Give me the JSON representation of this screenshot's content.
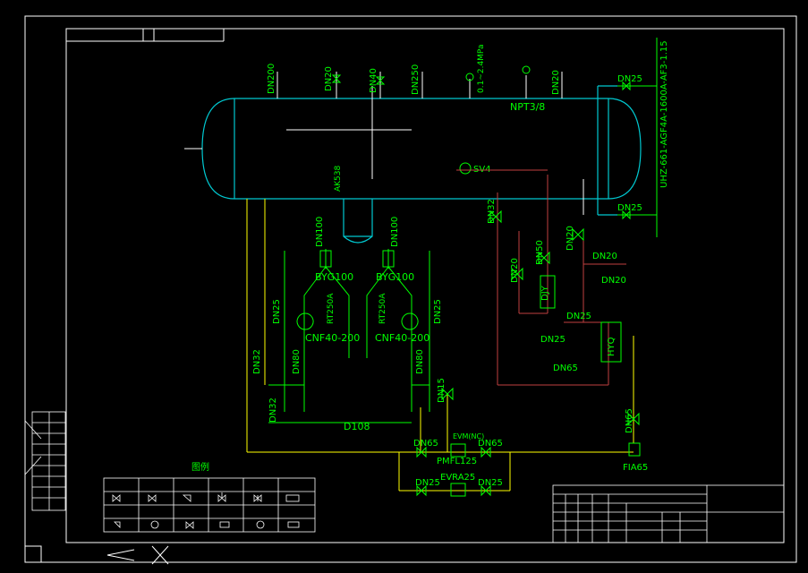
{
  "colors": {
    "background": "#000000",
    "frame": "#ffffff",
    "tank": "#00c8d0",
    "pipe_green": "#00ff00",
    "pipe_yellow": "#ffff00",
    "pipe_red": "#c04040",
    "magenta": "#ff00ff",
    "red_tag": "#ff2020"
  },
  "tank_labels": {
    "top_nozzles": [
      "DN200",
      "DN20",
      "DN40",
      "DN250",
      "DN20"
    ],
    "npt": "NPT3/8",
    "dn25_top": "DN25",
    "dn25_bottom": "DN25",
    "side_line": "UHZ-661-AGF4A-1600A-AF3-1.15",
    "pressure_gauge": "0.1~2.4MPa",
    "safety_valve": "SV4",
    "level_gauge": "AK538"
  },
  "pumps": {
    "dn100_left": "DN100",
    "dn100_right": "DN100",
    "byg_left": "BYG100",
    "byg_right": "BYG100",
    "cnf_left": "CNF40-200",
    "cnf_right": "CNF40-200",
    "rt_left": "RT250A",
    "rt_right": "RT250A",
    "dn25_left": "DN25",
    "dn25_right": "DN25",
    "dn32_a": "DN32",
    "dn32_b": "DN32",
    "dn80_left": "DN80",
    "dn80_right": "DN80",
    "header": "D108",
    "dn15": "DN15",
    "dn32_c": "DN32"
  },
  "right_system": {
    "dn50": "DN50",
    "dn20_a": "DN20",
    "dn20_b": "DN20",
    "dn20_c": "DN20",
    "dn20_d": "DN20",
    "dn25": "DN25",
    "dn25_b": "DN25",
    "dn65": "DN65",
    "dn65_b": "DN65",
    "djy": "DJY",
    "hyq": "HYQ",
    "fia": "FIA65"
  },
  "bottom_lines": {
    "dn65_left": "DN65",
    "dn65_right": "DN65",
    "evm": "EVM(NC)",
    "pmfl": "PMFL125",
    "dn25_left": "DN25",
    "dn25_right": "DN25",
    "evra": "EVRA25"
  },
  "legend": {
    "title": "图例",
    "icons": [
      "globe-valve-icon",
      "throttle-valve-icon",
      "angle-stop-valve-icon",
      "solenoid-valve-icon",
      "check-valve-icon",
      "strainer-icon",
      "safety-valve-icon",
      "pump-icon",
      "float-valve-icon",
      "pressure-reducing-valve-icon",
      "pressure-gauge-icon",
      "sight-glass-icon"
    ]
  }
}
